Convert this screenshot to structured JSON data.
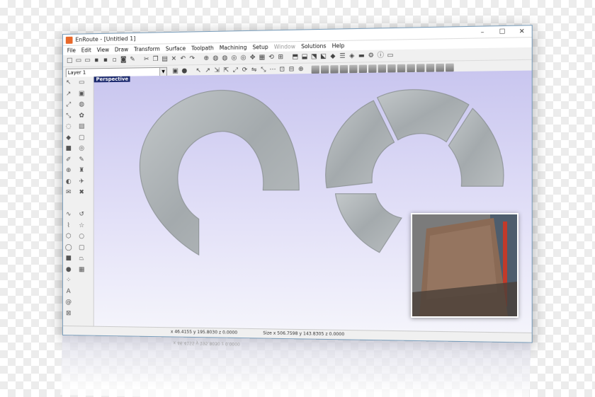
{
  "window": {
    "title": "EnRoute - [Untitled 1]",
    "controls": [
      "–",
      "☐",
      "✕"
    ]
  },
  "menu": [
    "File",
    "Edit",
    "View",
    "Draw",
    "Transform",
    "Surface",
    "Toolpath",
    "Machining",
    "Setup",
    "Window",
    "Solutions",
    "Help"
  ],
  "menu_disabled": "Window",
  "layer_select": {
    "value": "Layer 1"
  },
  "viewport": {
    "label": "Perspective"
  },
  "status": {
    "coords": "x 46.4155  y 195.8030  z 0.0000",
    "size": "Size x 506.7598  y 143.8305  z 0.0000"
  },
  "colors": {
    "accent": "#e8682a",
    "viewport_top": "#c9c6ef",
    "metal": "#aab0b3",
    "label_bg": "#1c2a6e"
  },
  "icons": {
    "title": "enroute-logo-icon",
    "photo": "metal-cone-photo"
  }
}
